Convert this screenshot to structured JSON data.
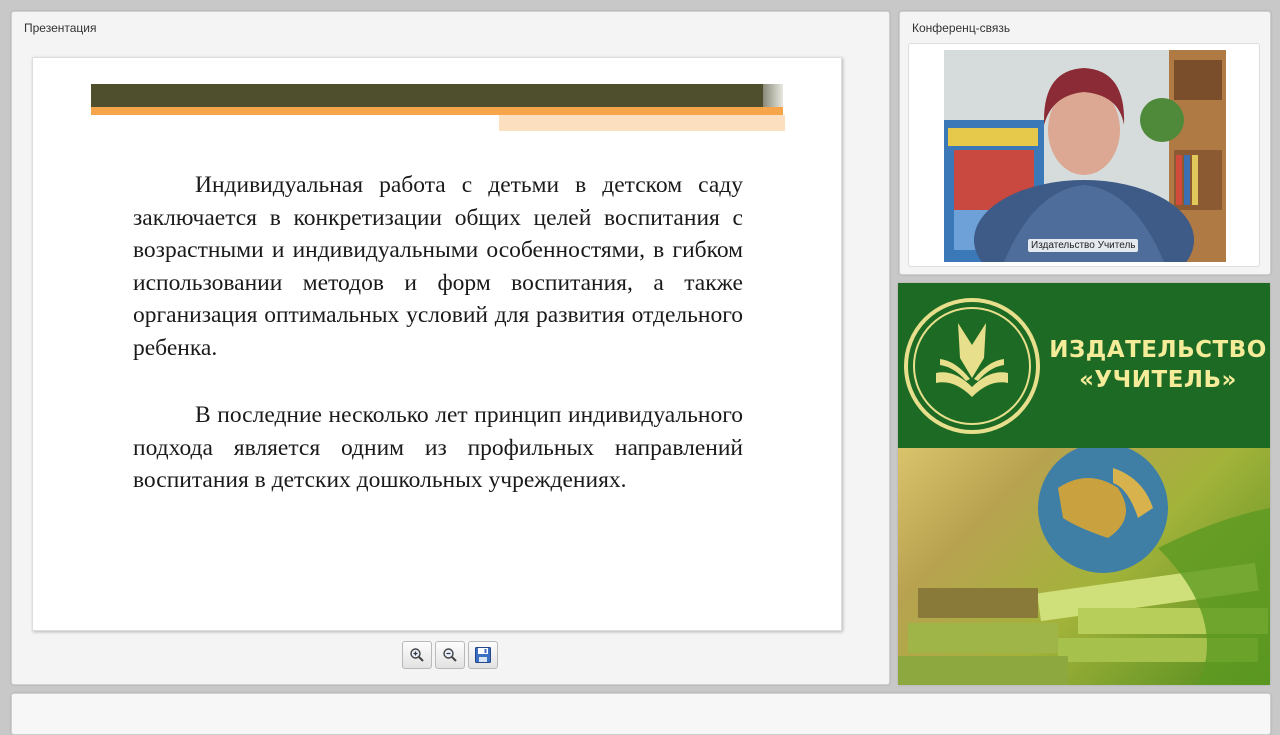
{
  "presentation": {
    "title": "Презентация",
    "slide": {
      "paragraph1": "Индивидуальная работа с детьми в детском саду заключается в конкретизации общих целей воспитания с возрастными и индивидуальными особенностями, в гибком использовании методов и форм воспитания, а также организация оптимальных условий для развития отдельного ребенка.",
      "paragraph2": "В последние несколько лет принцип индивидуального подхода является одним из профильных направлений воспитания в детских дошкольных учреждениях."
    },
    "toolbar": [
      "zoom-in-icon",
      "zoom-out-icon",
      "save-icon"
    ]
  },
  "conference": {
    "title": "Конференц-связь",
    "participant_name": "Издательство Учитель"
  },
  "brand": {
    "line1": "ИЗДАТЕЛЬСТВО",
    "line2": "«УЧИТЕЛЬ»",
    "colors": {
      "green": "#1d6a24",
      "text": "#f5ec9a"
    }
  }
}
